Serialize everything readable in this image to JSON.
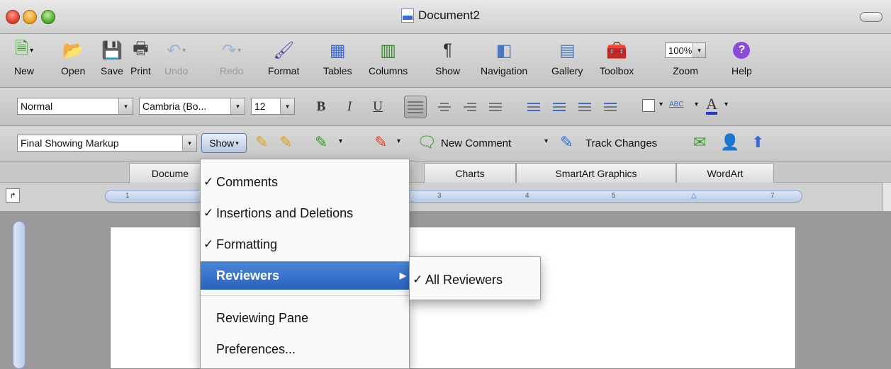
{
  "window": {
    "title": "Document2"
  },
  "standard_toolbar": {
    "items": [
      {
        "label": "New",
        "icon": "new-document-icon"
      },
      {
        "label": "Open",
        "icon": "open-folder-icon"
      },
      {
        "label": "Save",
        "icon": "save-disk-icon"
      },
      {
        "label": "Print",
        "icon": "printer-icon"
      },
      {
        "label": "Undo",
        "icon": "undo-arrow-icon",
        "disabled": true
      },
      {
        "label": "Redo",
        "icon": "redo-arrow-icon",
        "disabled": true
      },
      {
        "label": "Format",
        "icon": "format-brush-icon"
      },
      {
        "label": "Tables",
        "icon": "table-grid-icon"
      },
      {
        "label": "Columns",
        "icon": "columns-icon"
      },
      {
        "label": "Show",
        "icon": "pilcrow-icon"
      },
      {
        "label": "Navigation",
        "icon": "navigation-pane-icon"
      },
      {
        "label": "Gallery",
        "icon": "gallery-icon"
      },
      {
        "label": "Toolbox",
        "icon": "toolbox-icon"
      },
      {
        "label": "Zoom",
        "icon": "zoom-select"
      },
      {
        "label": "Help",
        "icon": "help-icon"
      }
    ],
    "zoom_value": "100%"
  },
  "formatting_toolbar": {
    "style": "Normal",
    "font": "Cambria (Bo...",
    "size": "12",
    "bold": "B",
    "italic": "I",
    "underline": "U",
    "font_color_glyph": "A",
    "spell_glyph": "ABC"
  },
  "reviewing_toolbar": {
    "markup_view": "Final Showing Markup",
    "show_button": "Show",
    "new_comment": "New Comment",
    "track_changes": "Track Changes"
  },
  "ribbon_tabs": [
    "Docume",
    "Charts",
    "SmartArt Graphics",
    "WordArt"
  ],
  "ruler": {
    "marks": [
      "1",
      "3",
      "4",
      "5",
      "7"
    ]
  },
  "show_menu": {
    "items": [
      {
        "label": "Comments",
        "checked": true
      },
      {
        "label": "Insertions and Deletions",
        "checked": true
      },
      {
        "label": "Formatting",
        "checked": true
      },
      {
        "label": "Reviewers",
        "checked": false,
        "highlighted": true,
        "has_submenu": true
      },
      {
        "label": "Reviewing Pane",
        "checked": false
      },
      {
        "label": "Preferences...",
        "checked": false
      }
    ],
    "check_glyph": "✓"
  },
  "reviewers_submenu": {
    "items": [
      {
        "label": "All Reviewers",
        "checked": true
      }
    ]
  },
  "colors": {
    "highlight": "#2a62c0",
    "close": "#d8341f",
    "minimize": "#e89a16",
    "zoom": "#4aa226"
  }
}
